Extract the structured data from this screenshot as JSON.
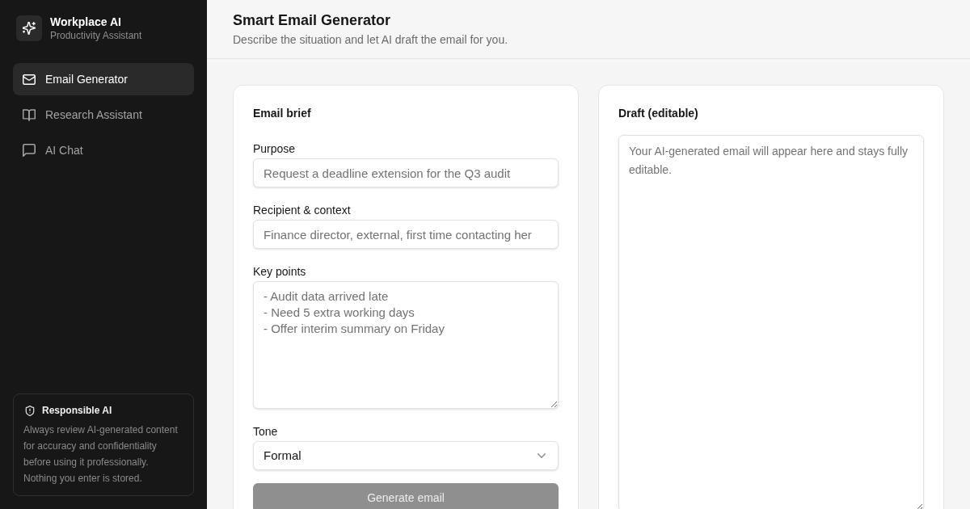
{
  "sidebar": {
    "brand": {
      "title": "Workplace AI",
      "subtitle": "Productivity Assistant"
    },
    "items": [
      {
        "label": "Email Generator",
        "selected": true
      },
      {
        "label": "Research Assistant",
        "selected": false
      },
      {
        "label": "AI Chat",
        "selected": false
      }
    ],
    "notice": {
      "title": "Responsible AI",
      "text": "Always review AI-generated content for accuracy and confidentiality before using it professionally. Nothing you enter is stored."
    }
  },
  "header": {
    "title": "Smart Email Generator",
    "subtitle": "Describe the situation and let AI draft the email for you."
  },
  "brief": {
    "title": "Email brief",
    "fields": [
      {
        "kind": "input",
        "label": "Purpose",
        "placeholder": "Request a deadline extension for the Q3 audit"
      },
      {
        "kind": "input",
        "label": "Recipient & context",
        "placeholder": "Finance director, external, first time contacting her"
      },
      {
        "kind": "textarea",
        "label": "Key points",
        "placeholder": "- Audit data arrived late\n- Need 5 extra working days\n- Offer interim summary on Friday"
      },
      {
        "kind": "select",
        "label": "Tone",
        "value": "Formal"
      }
    ],
    "button": {
      "label": "Generate email",
      "disabled": true
    }
  },
  "draft": {
    "title": "Draft (editable)",
    "placeholder": "Your AI-generated email will appear here and stays fully editable."
  }
}
